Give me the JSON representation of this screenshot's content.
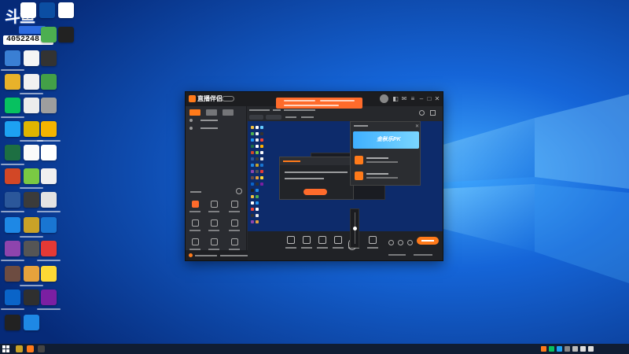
{
  "desktop": {
    "banner": {
      "logo_text": "斗鱼",
      "user_id": "4052248"
    }
  },
  "app": {
    "name": "直播伴侣",
    "preview_popup": {
      "banner_text": "金秋乐PK"
    }
  },
  "colors": {
    "accent": "#ff7a1a",
    "wallpaper_dark": "#06236e",
    "wallpaper_light": "#1f8df0",
    "app_bg": "#26282c"
  },
  "icons": {
    "titlebar": [
      "avatar-icon",
      "skin-icon",
      "message-icon",
      "menu-icon",
      "minimize-icon",
      "maximize-icon",
      "close-icon"
    ],
    "controls": [
      "screen-capture-icon",
      "camera-icon",
      "window-capture-icon",
      "text-icon",
      "more-icon",
      "microphone-icon",
      "speaker-icon"
    ]
  }
}
